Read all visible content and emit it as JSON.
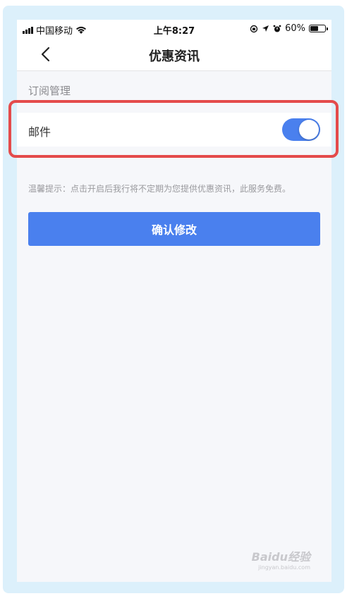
{
  "status_bar": {
    "carrier": "中国移动",
    "time": "上午8:27",
    "battery_percent": "60%",
    "battery_level": 0.6
  },
  "nav": {
    "title": "优惠资讯",
    "back_icon": "chevron-left-icon"
  },
  "section": {
    "label": "订阅管理"
  },
  "settings": [
    {
      "label": "邮件",
      "enabled": true
    }
  ],
  "tip": "温馨提示：点击开启后我行将不定期为您提供优惠资讯，此服务免费。",
  "confirm_button": "确认修改",
  "watermark": {
    "brand": "Baidu经验",
    "url": "jingyan.baidu.com"
  },
  "colors": {
    "accent": "#4a80ee",
    "highlight": "#e44b4b",
    "frame": "#dcf0fb"
  }
}
